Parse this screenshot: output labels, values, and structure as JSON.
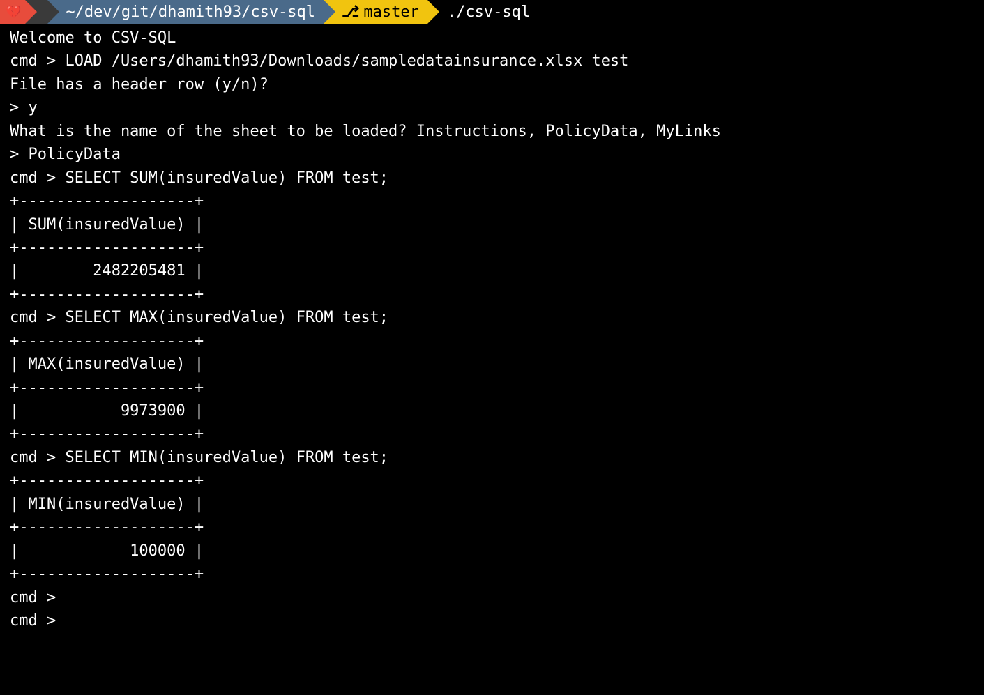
{
  "prompt": {
    "heart_icon": "💔",
    "apple_icon": "",
    "path": "~/dev/git/dhamith93/csv-sql",
    "branch_icon": "⎇",
    "branch": "master",
    "command": "./csv-sql"
  },
  "session": {
    "welcome": "Welcome to CSV-SQL",
    "lines": [
      "cmd > LOAD /Users/dhamith93/Downloads/sampledatainsurance.xlsx test",
      "File has a header row (y/n)?",
      "> y",
      "What is the name of the sheet to be loaded? Instructions, PolicyData, MyLinks",
      "> PolicyData",
      "cmd > SELECT SUM(insuredValue) FROM test;",
      "+-------------------+",
      "| SUM(insuredValue) |",
      "+-------------------+",
      "|        2482205481 |",
      "+-------------------+",
      "cmd > SELECT MAX(insuredValue) FROM test;",
      "+-------------------+",
      "| MAX(insuredValue) |",
      "+-------------------+",
      "|           9973900 |",
      "+-------------------+",
      "cmd > SELECT MIN(insuredValue) FROM test;",
      "+-------------------+",
      "| MIN(insuredValue) |",
      "+-------------------+",
      "|            100000 |",
      "+-------------------+",
      "cmd >",
      "cmd >"
    ]
  },
  "query_results": {
    "sum_insured_value": 2482205481,
    "max_insured_value": 9973900,
    "min_insured_value": 100000
  }
}
